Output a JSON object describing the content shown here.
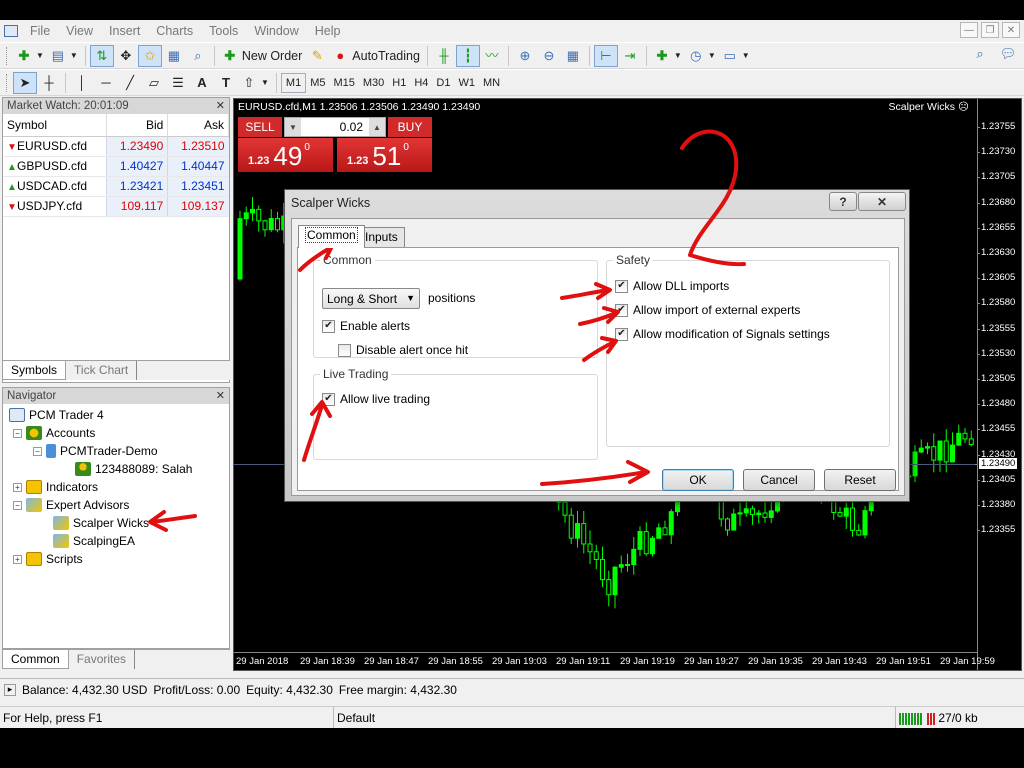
{
  "menu": [
    "File",
    "View",
    "Insert",
    "Charts",
    "Tools",
    "Window",
    "Help"
  ],
  "toolbar": {
    "new_order": "New Order",
    "autotrading": "AutoTrading",
    "timeframes": [
      "M1",
      "M5",
      "M15",
      "M30",
      "H1",
      "H4",
      "D1",
      "W1",
      "MN"
    ],
    "active_timeframe": "M1"
  },
  "market_watch": {
    "title": "Market Watch: 20:01:09",
    "headers": [
      "Symbol",
      "Bid",
      "Ask"
    ],
    "rows": [
      {
        "symbol": "EURUSD.cfd",
        "bid": "1.23490",
        "ask": "1.23510",
        "dir": "down"
      },
      {
        "symbol": "GBPUSD.cfd",
        "bid": "1.40427",
        "ask": "1.40447",
        "dir": "up"
      },
      {
        "symbol": "USDCAD.cfd",
        "bid": "1.23421",
        "ask": "1.23451",
        "dir": "up"
      },
      {
        "symbol": "USDJPY.cfd",
        "bid": "109.117",
        "ask": "109.137",
        "dir": "down"
      }
    ],
    "tabs": [
      "Symbols",
      "Tick Chart"
    ]
  },
  "navigator": {
    "title": "Navigator",
    "root": "PCM Trader 4",
    "accounts": "Accounts",
    "account_server": "PCMTrader-Demo",
    "account_user": "123488089: Salah",
    "indicators": "Indicators",
    "experts": "Expert Advisors",
    "ea1": "Scalper Wicks",
    "ea2": "ScalpingEA",
    "scripts": "Scripts",
    "tabs": [
      "Common",
      "Favorites"
    ]
  },
  "chart": {
    "title": "EURUSD.cfd,M1 1.23506 1.23506 1.23490 1.23490",
    "ea_name": "Scalper Wicks",
    "current_price": "1.23490",
    "price_labels": [
      "1.23755",
      "1.23730",
      "1.23705",
      "1.23680",
      "1.23655",
      "1.23630",
      "1.23605",
      "1.23580",
      "1.23555",
      "1.23530",
      "1.23505",
      "1.23480",
      "1.23455",
      "1.23430",
      "1.23405",
      "1.23380",
      "1.23355"
    ],
    "time_labels": [
      "29 Jan 2018",
      "29 Jan 18:39",
      "29 Jan 18:47",
      "29 Jan 18:55",
      "29 Jan 19:03",
      "29 Jan 19:11",
      "29 Jan 19:19",
      "29 Jan 19:27",
      "29 Jan 19:35",
      "29 Jan 19:43",
      "29 Jan 19:51",
      "29 Jan 19:59"
    ],
    "one_click": {
      "sell": "SELL",
      "buy": "BUY",
      "lot": "0.02",
      "sell_prefix": "1.23",
      "sell_big": "49",
      "sell_sup": "0",
      "buy_prefix": "1.23",
      "buy_big": "51",
      "buy_sup": "0"
    }
  },
  "dialog": {
    "title": "Scalper Wicks",
    "help": "?",
    "close": "✕",
    "tabs": [
      "Common",
      "Inputs"
    ],
    "common_group": "Common",
    "positions_value": "Long & Short",
    "positions_label": "positions",
    "enable_alerts": "Enable alerts",
    "disable_alert_once": "Disable alert once hit",
    "live_group": "Live Trading",
    "allow_live": "Allow live trading",
    "safety_group": "Safety",
    "allow_dll": "Allow DLL imports",
    "allow_import": "Allow import of external experts",
    "allow_signals": "Allow modification of Signals settings",
    "ok": "OK",
    "cancel": "Cancel",
    "reset": "Reset"
  },
  "balance_line": {
    "balance": "Balance: 4,432.30 USD",
    "pl": "Profit/Loss: 0.00",
    "equity": "Equity: 4,432.30",
    "margin": "Free margin: 4,432.30"
  },
  "status": {
    "help": "For Help, press F1",
    "profile": "Default",
    "traffic": "27/0 kb"
  },
  "colors": {
    "sell_red": "#d12a2a",
    "candle_green": "#00ff00",
    "annotation_red": "#e01010"
  }
}
